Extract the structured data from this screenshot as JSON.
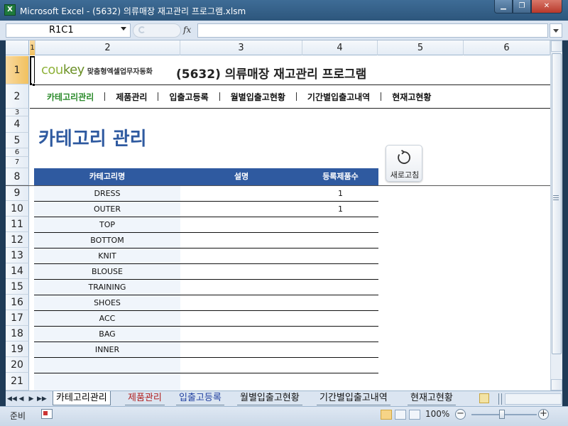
{
  "window": {
    "app_icon": "X",
    "title": "Microsoft Excel - (5632) 의류매장 재고관리 프로그램.xlsm",
    "min_glyph": "▁",
    "max_glyph": "❐",
    "close_glyph": "✕"
  },
  "formula_bar": {
    "name_box": "R1C1",
    "fx": "fx",
    "value": ""
  },
  "columns": [
    "1",
    "2",
    "3",
    "4",
    "5",
    "6"
  ],
  "rows": [
    "1",
    "2",
    "3",
    "4",
    "5",
    "6",
    "7",
    "8",
    "9",
    "10",
    "11",
    "12",
    "13",
    "14",
    "15",
    "16",
    "17",
    "18",
    "19",
    "20",
    "21"
  ],
  "logo": {
    "brand_a": "cou",
    "brand_b": "key",
    "tagline": "맞춤형엑셀업무자동화"
  },
  "program_title": "(5632) 의류매장 재고관리 프로그램",
  "nav": [
    "카테고리관리",
    "제품관리",
    "입출고등록",
    "월별입출고현황",
    "기간별입출고내역",
    "현재고현황"
  ],
  "page_heading": "카테고리 관리",
  "refresh_button": {
    "label": "새로고침",
    "icon": "refresh-icon"
  },
  "table": {
    "headers": [
      "카테고리명",
      "설명",
      "등록제품수"
    ],
    "rows": [
      {
        "category": "DRESS",
        "description": "",
        "count": "1"
      },
      {
        "category": "OUTER",
        "description": "",
        "count": "1"
      },
      {
        "category": "TOP",
        "description": "",
        "count": ""
      },
      {
        "category": "BOTTOM",
        "description": "",
        "count": ""
      },
      {
        "category": "KNIT",
        "description": "",
        "count": ""
      },
      {
        "category": "BLOUSE",
        "description": "",
        "count": ""
      },
      {
        "category": "TRAINING",
        "description": "",
        "count": ""
      },
      {
        "category": "SHOES",
        "description": "",
        "count": ""
      },
      {
        "category": "ACC",
        "description": "",
        "count": ""
      },
      {
        "category": "BAG",
        "description": "",
        "count": ""
      },
      {
        "category": "INNER",
        "description": "",
        "count": ""
      },
      {
        "category": "",
        "description": "",
        "count": ""
      },
      {
        "category": "",
        "description": "",
        "count": ""
      }
    ]
  },
  "sheet_tabs": [
    "카테고리관리",
    "제품관리",
    "입출고등록",
    "월별입출고현황",
    "기간별입출고내역",
    "현재고현황"
  ],
  "tab_nav": [
    "◀◀",
    "◀",
    "▶",
    "▶▶"
  ],
  "status": {
    "ready": "준비",
    "zoom": "100%",
    "zoom_out": "−",
    "zoom_in": "+"
  },
  "colors": {
    "accent": "#2f5aa0",
    "nav_active": "#2a8a2a",
    "logo_green": "#8fb23a",
    "category_bg": "#f0f5fb"
  }
}
